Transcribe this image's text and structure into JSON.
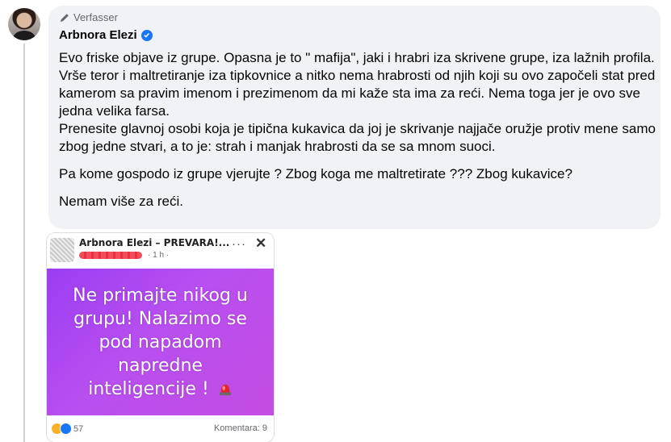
{
  "comment": {
    "author_tag": "Verfasser",
    "author_name": "Arbnora Elezi",
    "verified": true,
    "paragraphs": [
      "Evo friske objave iz grupe. Opasna je to \" mafija\", jaki i hrabri iza skrivene grupe, iza lažnih profila. Vrše teror i maltretiranje iza tipkovnice a nitko nema hrabrosti od njih koji su ovo započeli stat pred kamerom sa pravim imenom i prezimenom da mi kaže sta ima za reći. Nema toga jer je ovo sve jedna velika farsa.",
      "Prenesite glavnoj osobi koja je tipična kukavica da joj je skrivanje najjače oružje protiv mene samo zbog jedne stvari, a to je: strah i manjak hrabrosti da se sa mnom suoci.",
      "Pa kome gospodo iz grupe vjerujte ? Zbog koga me maltretirate ??? Zbog kukavice?",
      "Nemam više za reći."
    ]
  },
  "attachment": {
    "header_title": "Arbnora Elezi – PREVARA!...",
    "header_time": "· 1 h ·",
    "post_lines": [
      "Ne primajte nikog u",
      "grupu! Nalazimo se",
      "pod napadom",
      "napredne",
      "inteligencije !"
    ],
    "reaction_count": "57",
    "comments_label": "Komentara: 9"
  },
  "colors": {
    "bubble": "#f0f2f5",
    "verified": "#1877f2",
    "post_background": "#a844f0"
  },
  "icons": {
    "author_tag": "pencil-icon",
    "verified": "verified-badge-icon",
    "close": "close-icon",
    "more": "more-dots-icon",
    "siren": "siren-emoji-icon"
  }
}
